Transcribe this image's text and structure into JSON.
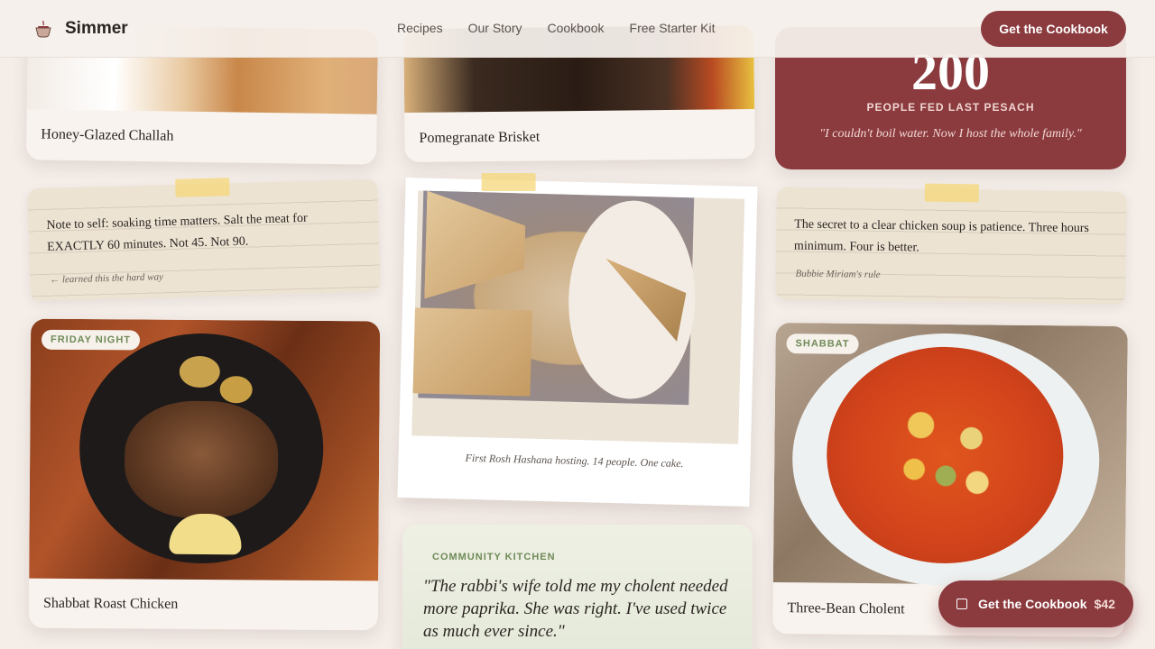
{
  "header": {
    "brand_name": "Simmer",
    "brand_icon": "pot-icon",
    "nav": [
      "Recipes",
      "Our Story",
      "Cookbook",
      "Free Starter Kit"
    ],
    "cta_label": "Get the Cookbook"
  },
  "cards": {
    "challah": {
      "caption": "Honey-Glazed Challah"
    },
    "brisket": {
      "caption": "Pomegranate Brisket"
    },
    "stat": {
      "number": "200",
      "label": "PEOPLE FED LAST PESACH",
      "quote": "\"I couldn't boil water. Now I host the whole family.\""
    },
    "note_left": {
      "text": "Note to self: soaking time matters. Salt the meat for EXACTLY 60 minutes. Not 45. Not 90.",
      "sign": "← learned this the hard way"
    },
    "polaroid": {
      "caption": "First Rosh Hashana hosting. 14 people. One cake."
    },
    "note_right": {
      "text": "The secret to a clear chicken soup is patience. Three hours minimum. Four is better.",
      "sign": "Bubbie Miriam's rule"
    },
    "chicken": {
      "tag": "FRIDAY NIGHT",
      "caption": "Shabbat Roast Chicken"
    },
    "community": {
      "label": "COMMUNITY KITCHEN",
      "quote": "\"The rabbi's wife told me my cholent needed more paprika. She was right. I've used twice as much ever since.\""
    },
    "cholent": {
      "tag": "SHABBAT",
      "caption": "Three-Bean Cholent"
    }
  },
  "floating_cta": {
    "icon": "cart-icon",
    "label": "Get the Cookbook",
    "price": "$42"
  },
  "colors": {
    "background": "#f4ede8",
    "accent": "#8b3a3e",
    "tag_green": "#6f8a57",
    "note_paper": "#ece3d3",
    "tape": "#f5d778"
  }
}
